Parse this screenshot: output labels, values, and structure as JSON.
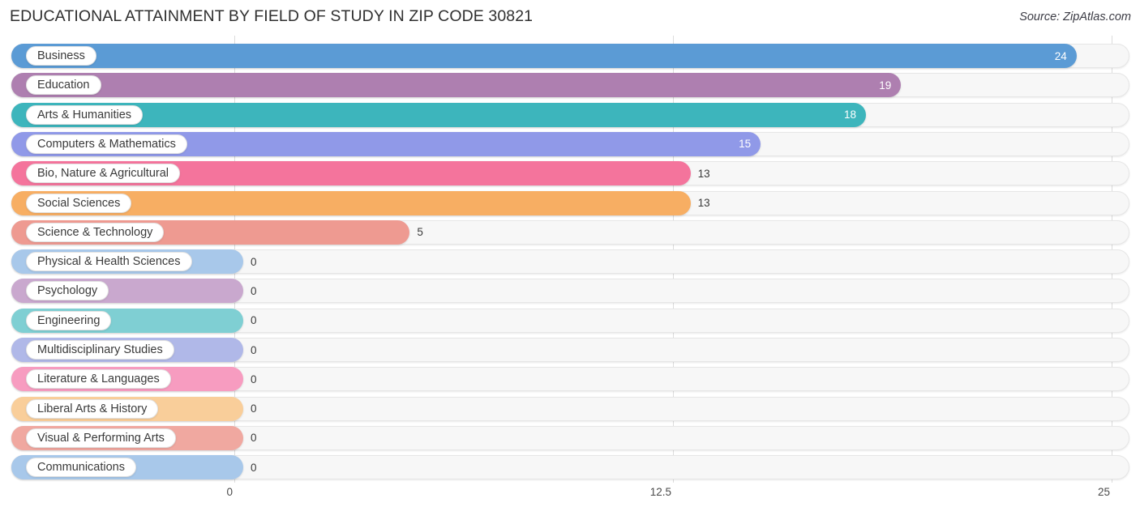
{
  "header": {
    "title": "EDUCATIONAL ATTAINMENT BY FIELD OF STUDY IN ZIP CODE 30821",
    "source": "Source: ZipAtlas.com"
  },
  "chart_data": {
    "type": "bar",
    "orientation": "horizontal",
    "title": "EDUCATIONAL ATTAINMENT BY FIELD OF STUDY IN ZIP CODE 30821",
    "xlabel": "",
    "ylabel": "",
    "xlim": [
      0,
      25
    ],
    "grid": true,
    "legend": "none",
    "xticks": [
      "0",
      "12.5",
      "25"
    ],
    "xtick_values": [
      0,
      12.5,
      25
    ],
    "categories": [
      "Business",
      "Education",
      "Arts & Humanities",
      "Computers & Mathematics",
      "Bio, Nature & Agricultural",
      "Social Sciences",
      "Science & Technology",
      "Physical & Health Sciences",
      "Psychology",
      "Engineering",
      "Multidisciplinary Studies",
      "Literature & Languages",
      "Liberal Arts & History",
      "Visual & Performing Arts",
      "Communications"
    ],
    "values": [
      24,
      19,
      18,
      15,
      13,
      13,
      5,
      0,
      0,
      0,
      0,
      0,
      0,
      0,
      0
    ],
    "value_labels": [
      "24",
      "19",
      "18",
      "15",
      "13",
      "13",
      "5",
      "0",
      "0",
      "0",
      "0",
      "0",
      "0",
      "0",
      "0"
    ],
    "colors": [
      "#5b9bd5",
      "#ae7fb0",
      "#3db5bc",
      "#9099e8",
      "#f4749c",
      "#f7ae63",
      "#ee9a91",
      "#a8c8ea",
      "#c9a8ce",
      "#7fcfd3",
      "#b0b8e8",
      "#f79cc0",
      "#f9ce9a",
      "#f0a8a0",
      "#a8c8ea"
    ]
  }
}
